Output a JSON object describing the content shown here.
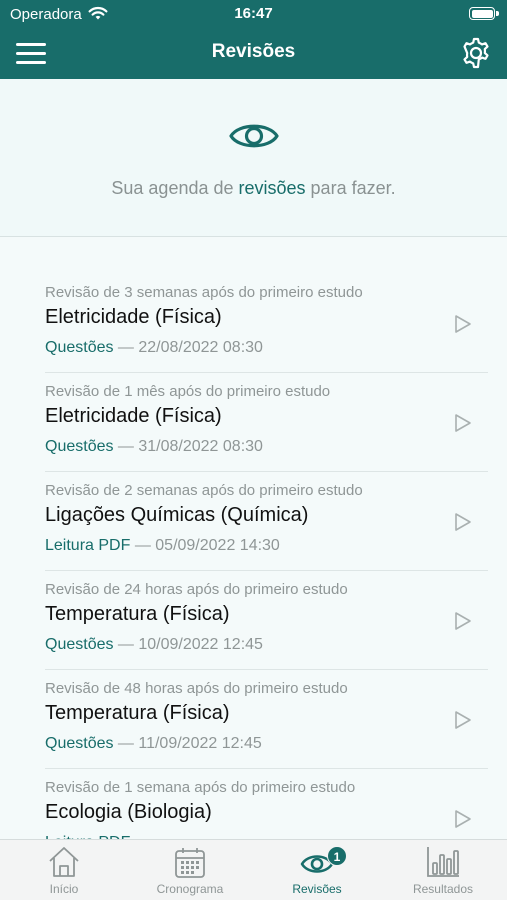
{
  "status_bar": {
    "carrier": "Operadora",
    "time": "16:47"
  },
  "nav": {
    "title": "Revisões",
    "menu_icon": "hamburger-menu-icon",
    "settings_icon": "gear-icon"
  },
  "hero": {
    "text_before": "Sua agenda de ",
    "text_accent": "revisões",
    "text_after": " para fazer.",
    "icon": "eye-icon"
  },
  "colors": {
    "primary": "#186d6a",
    "muted": "#8f9696",
    "background": "#f4fafa"
  },
  "reviews": [
    {
      "subtitle": "Revisão de 3 semanas após do primeiro estudo",
      "title": "Eletricidade (Física)",
      "type": "Questões",
      "datetime": "22/08/2022 08:30"
    },
    {
      "subtitle": "Revisão de 1 mês após do primeiro estudo",
      "title": "Eletricidade (Física)",
      "type": "Questões",
      "datetime": "31/08/2022 08:30"
    },
    {
      "subtitle": "Revisão de 2 semanas após do primeiro estudo",
      "title": "Ligações Químicas (Química)",
      "type": "Leitura PDF",
      "datetime": "05/09/2022 14:30"
    },
    {
      "subtitle": "Revisão de 24 horas após do primeiro estudo",
      "title": "Temperatura (Física)",
      "type": "Questões",
      "datetime": "10/09/2022 12:45"
    },
    {
      "subtitle": "Revisão de 48 horas após do primeiro estudo",
      "title": "Temperatura (Física)",
      "type": "Questões",
      "datetime": "11/09/2022 12:45"
    },
    {
      "subtitle": "Revisão de 1 semana após do primeiro estudo",
      "title": "Ecologia (Biologia)",
      "type": "Leitura PDF",
      "datetime": ""
    }
  ],
  "tabs": [
    {
      "label": "Início",
      "icon": "home-icon",
      "active": false
    },
    {
      "label": "Cronograma",
      "icon": "calendar-icon",
      "active": false
    },
    {
      "label": "Revisões",
      "icon": "eye-icon",
      "active": true,
      "badge": "1"
    },
    {
      "label": "Resultados",
      "icon": "bar-chart-icon",
      "active": false
    }
  ]
}
